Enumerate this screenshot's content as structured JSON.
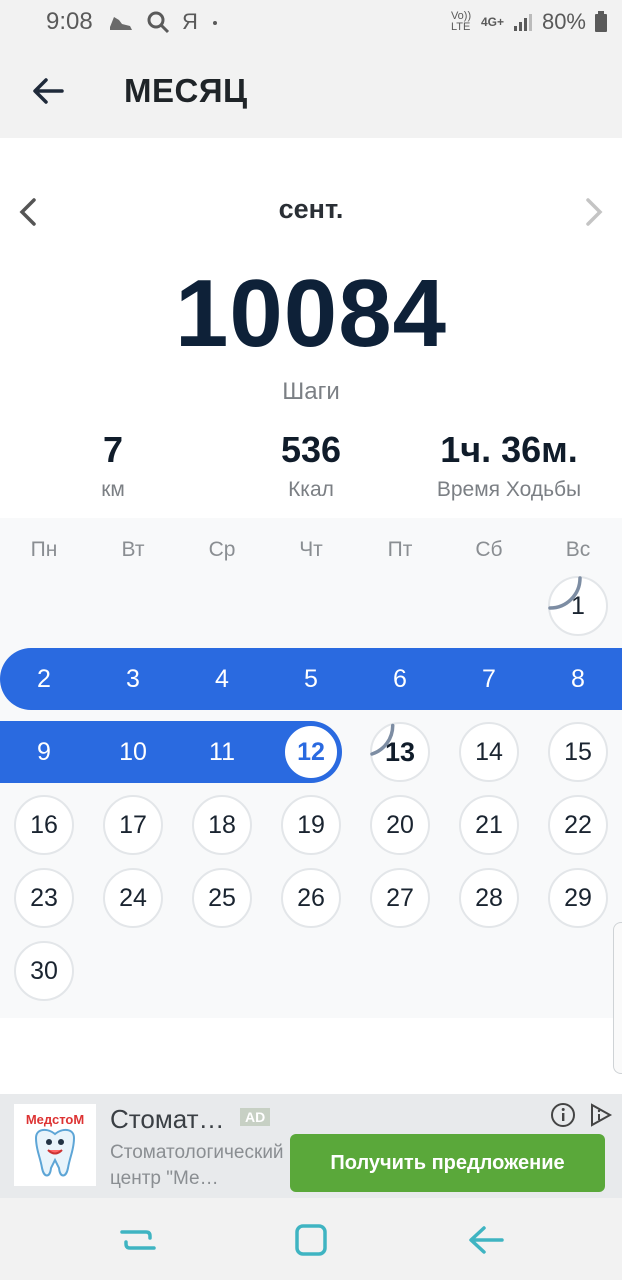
{
  "status_bar": {
    "time": "9:08",
    "left_icons": [
      "shoe-icon",
      "search-icon",
      "yandex-icon",
      "dot-icon"
    ],
    "yandex_glyph": "Я",
    "network_volte": "Vo)) LTE",
    "network_type": "4G+",
    "battery": "80%"
  },
  "app_bar": {
    "title": "МЕСЯЦ",
    "back_icon": "arrow-left-icon"
  },
  "month_nav": {
    "label": "сент.",
    "prev_icon": "chevron-left-icon",
    "next_icon": "chevron-right-icon"
  },
  "summary": {
    "steps": "10084",
    "steps_label": "Шаги",
    "stats": [
      {
        "value": "7",
        "label": "км"
      },
      {
        "value": "536",
        "label": "Ккал"
      },
      {
        "value": "1ч. 36м.",
        "label": "Время Ходьбы"
      }
    ]
  },
  "calendar": {
    "weekdays": [
      "Пн",
      "Вт",
      "Ср",
      "Чт",
      "Пт",
      "Сб",
      "Вс"
    ],
    "first_weekday_index": 6,
    "days_in_month": 30,
    "goal_days": [
      2,
      3,
      4,
      5,
      6,
      7,
      8,
      9,
      10,
      11,
      12
    ],
    "selected_day": 12,
    "current_day": 13,
    "partial_progress": [
      {
        "day": 1,
        "fraction": 0.25
      },
      {
        "day": 13,
        "fraction": 0.2
      }
    ]
  },
  "ad": {
    "logo_text": "МедстоМ",
    "title": "Стомат…",
    "badge": "AD",
    "description": "Стоматологический центр \"Ме…",
    "cta": "Получить предложение"
  },
  "nav_bar": {
    "icons": [
      "recent-apps-icon",
      "home-icon",
      "back-icon"
    ]
  },
  "colors": {
    "accent": "#2a6ae0",
    "cta": "#5aa83a",
    "steps_text": "#0e2138",
    "progress_arc": "#7d8da3"
  }
}
